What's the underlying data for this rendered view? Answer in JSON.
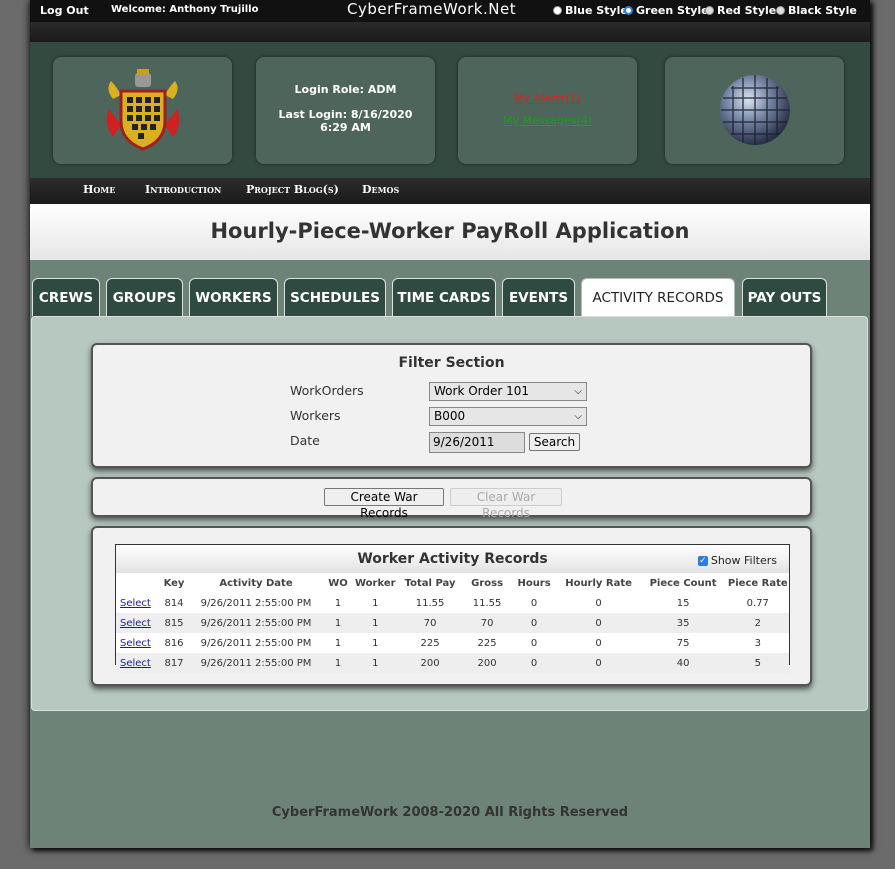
{
  "topbar": {
    "logout": "Log Out",
    "welcome": "Welcome: Anthony Trujillo",
    "site_name": "CyberFrameWork.Net",
    "styles": [
      {
        "label": "Blue Style",
        "selected": false
      },
      {
        "label": "Green Style",
        "selected": true
      },
      {
        "label": "Red Style",
        "selected": false
      },
      {
        "label": "Black Style",
        "selected": false
      }
    ]
  },
  "header": {
    "login_role": "Login Role: ADM",
    "last_login_line1": "Last Login: 8/16/2020",
    "last_login_line2": "6:29 AM",
    "alerts": "My Alerts(1)",
    "messages": "My Messages(4)"
  },
  "nav": [
    "Home",
    "Introduction",
    "Project Blog(s)",
    "Demos"
  ],
  "title": "Hourly-Piece-Worker PayRoll Application",
  "tabs": [
    "CREWS",
    "GROUPS",
    "WORKERS",
    "SCHEDULES",
    "TIME CARDS",
    "EVENTS",
    "ACTIVITY RECORDS",
    "PAY OUTS"
  ],
  "active_tab": "ACTIVITY RECORDS",
  "filter": {
    "title": "Filter Section",
    "workorders_label": "WorkOrders",
    "workorders_value": "Work Order 101",
    "workers_label": "Workers",
    "workers_value": "B000",
    "date_label": "Date",
    "date_value": "9/26/2011",
    "search": "Search"
  },
  "actions": {
    "create": "Create War Records",
    "clear": "Clear War Records"
  },
  "records": {
    "title": "Worker Activity Records",
    "show_filters": "Show Filters",
    "columns": [
      "",
      "Key",
      "Activity Date",
      "WO",
      "Worker",
      "Total Pay",
      "Gross",
      "Hours",
      "Hourly Rate",
      "Piece Count",
      "Piece Rate"
    ],
    "rows": [
      [
        "Select",
        "814",
        "9/26/2011 2:55:00 PM",
        "1",
        "1",
        "11.55",
        "11.55",
        "0",
        "0",
        "15",
        "0.77"
      ],
      [
        "Select",
        "815",
        "9/26/2011 2:55:00 PM",
        "1",
        "1",
        "70",
        "70",
        "0",
        "0",
        "35",
        "2"
      ],
      [
        "Select",
        "816",
        "9/26/2011 2:55:00 PM",
        "1",
        "1",
        "225",
        "225",
        "0",
        "0",
        "75",
        "3"
      ],
      [
        "Select",
        "817",
        "9/26/2011 2:55:00 PM",
        "1",
        "1",
        "200",
        "200",
        "0",
        "0",
        "40",
        "5"
      ]
    ]
  },
  "footer": "CyberFrameWork 2008-2020 All Rights Reserved"
}
